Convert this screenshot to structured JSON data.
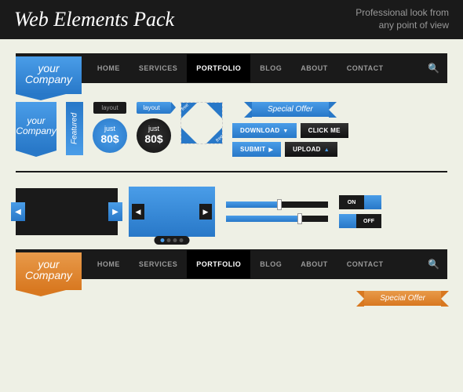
{
  "header": {
    "title": "Web Elements Pack",
    "tagline_l1": "Professional look from",
    "tagline_l2": "any point of view"
  },
  "nav": {
    "logo_l1": "your",
    "logo_l2": "Company",
    "items": [
      "HOME",
      "SERVICES",
      "PORTFOLIO",
      "BLOG",
      "ABOUT",
      "CONTACT"
    ],
    "active_index": 2
  },
  "ribbon": {
    "l1": "your",
    "l2": "Company"
  },
  "featured": "Featured",
  "tag_black": "layout",
  "tag_blue": "layout",
  "price_circle": {
    "prefix": "just",
    "amount": "80$"
  },
  "corner_label": "free",
  "special_offer": "Special Offer",
  "buttons": {
    "download": "DOWNLOAD",
    "click_me": "CLICK ME",
    "submit": "SUBMIT",
    "upload": "UPLOAD"
  },
  "progress": {
    "p1": 50,
    "p2": 70
  },
  "toggles": {
    "on": "ON",
    "off": "OFF"
  },
  "colors": {
    "blue": "#2878c8",
    "orange": "#d87820",
    "black": "#1a1a1a"
  }
}
